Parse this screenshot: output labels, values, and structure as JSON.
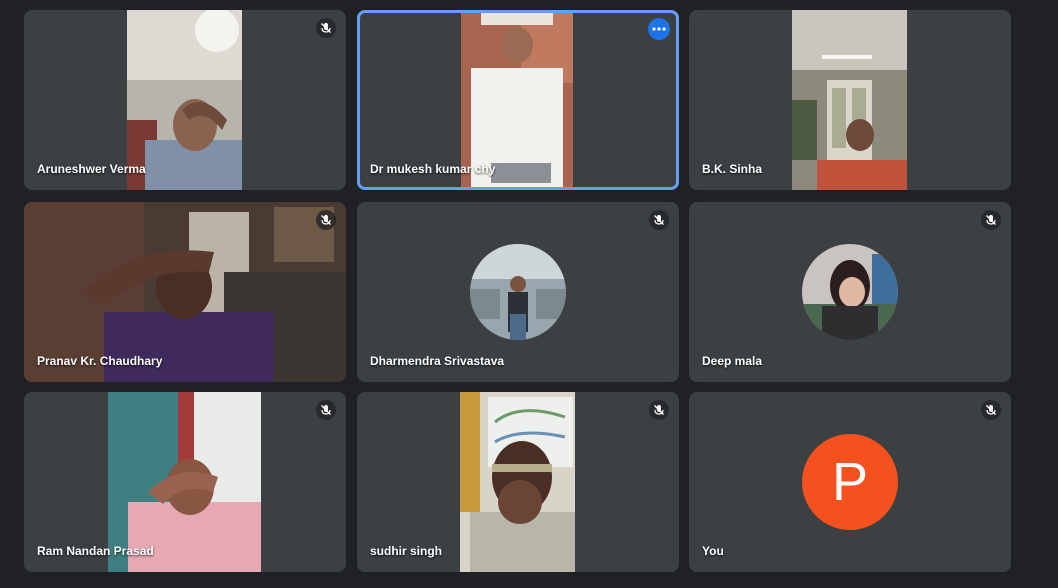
{
  "participants": [
    {
      "name": "Aruneshwer Verma",
      "muted": true
    },
    {
      "name": "Dr mukesh kumar chy",
      "muted": false,
      "active_speaker": true
    },
    {
      "name": "B.K. Sinha",
      "muted": false
    },
    {
      "name": "Pranav Kr. Chaudhary",
      "muted": true
    },
    {
      "name": "Dharmendra Srivastava",
      "muted": true
    },
    {
      "name": "Deep mala",
      "muted": true
    },
    {
      "name": "Ram Nandan Prasad",
      "muted": true
    },
    {
      "name": "sudhir singh",
      "muted": true
    },
    {
      "name": "You",
      "muted": true,
      "avatar_letter": "P",
      "avatar_color": "#f4511e"
    }
  ],
  "icons": {
    "mute": "mic-off-icon",
    "more": "more-options-icon"
  },
  "colors": {
    "background": "#202124",
    "tile": "#3c4043",
    "active_border": "#669df6",
    "more_button": "#1a73e8"
  }
}
